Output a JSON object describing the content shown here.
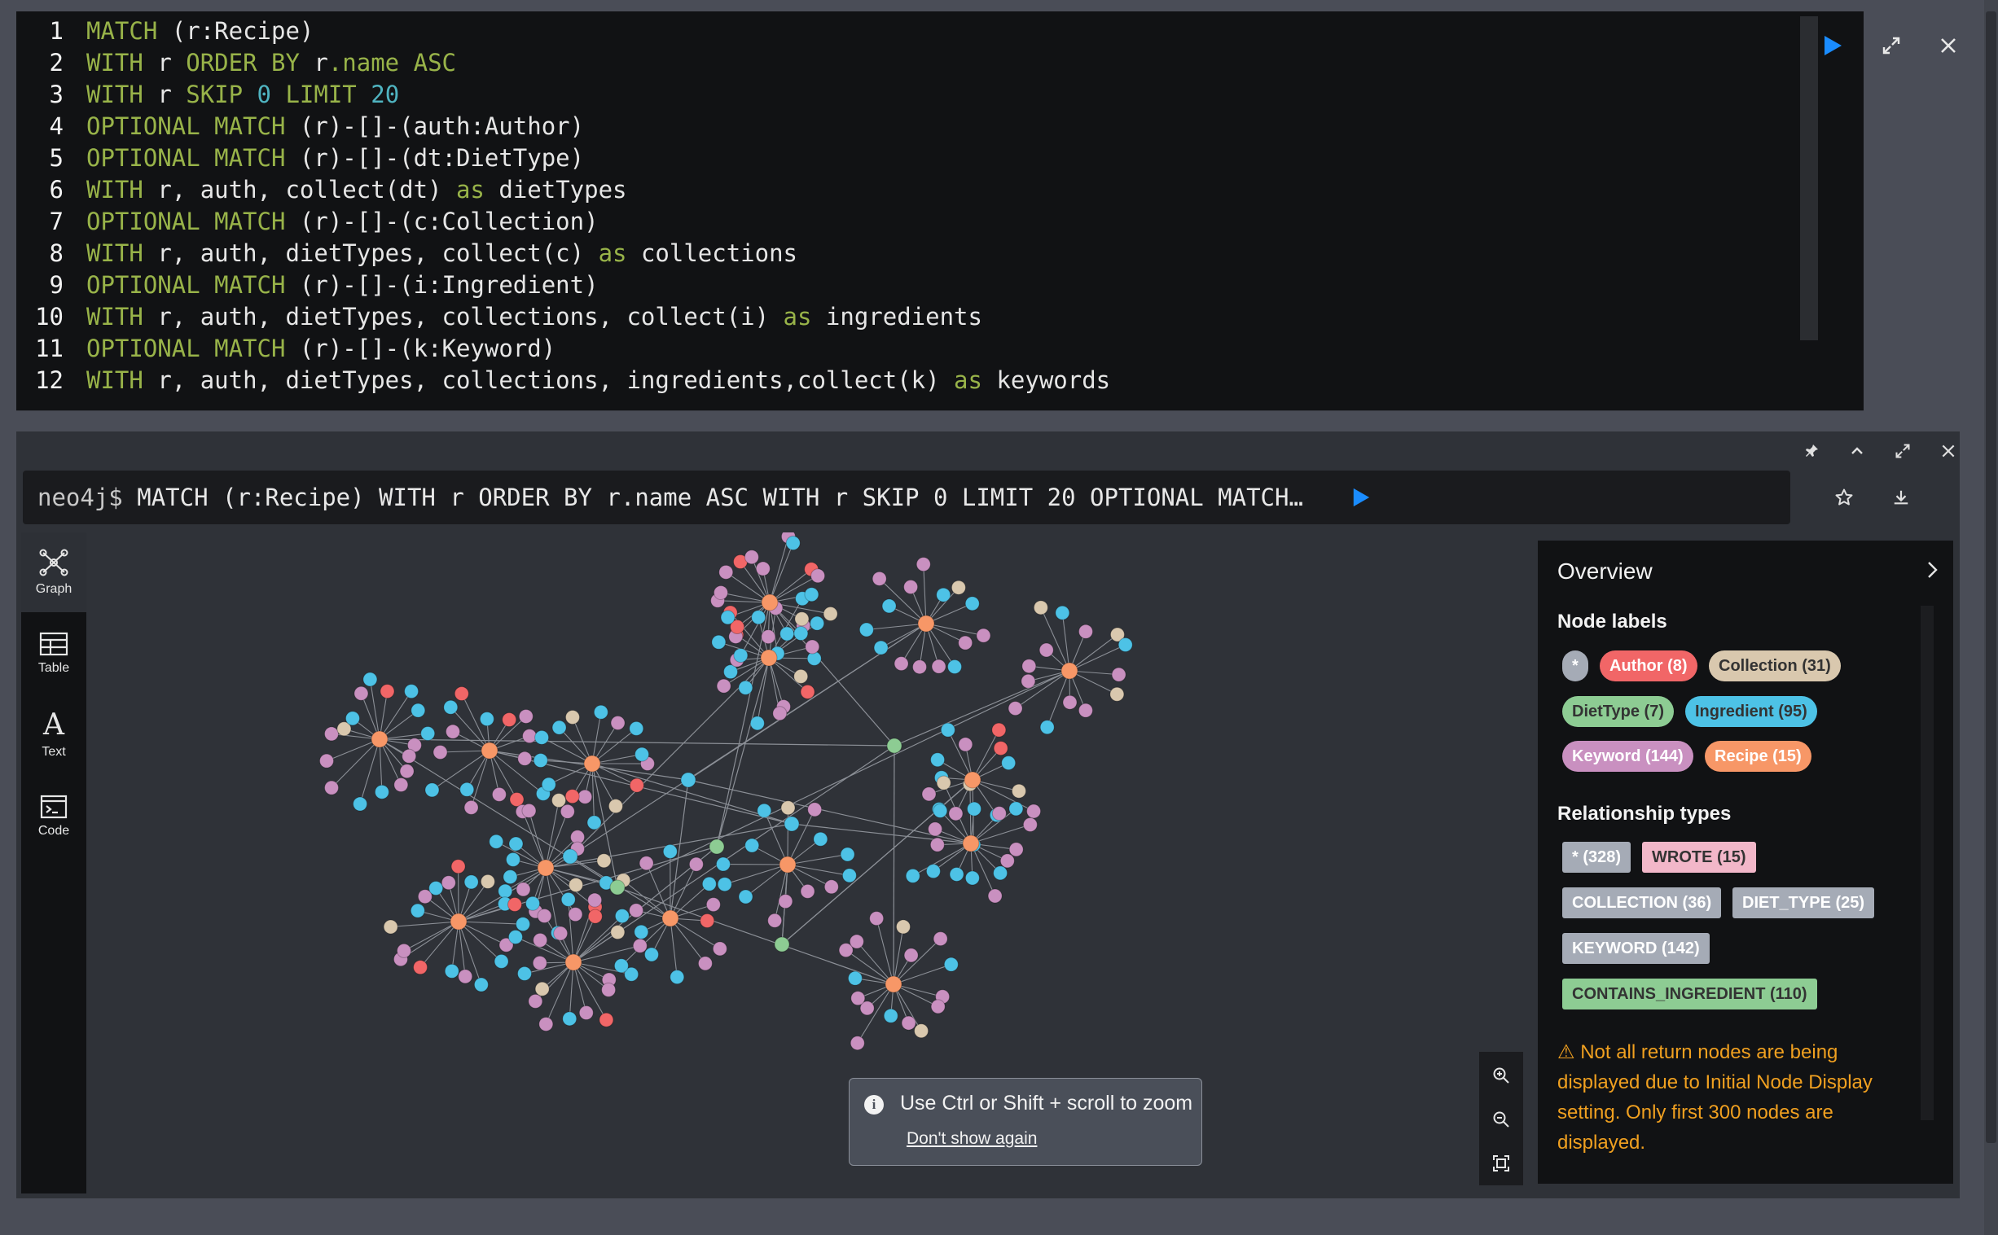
{
  "editor": {
    "lines": [
      {
        "n": "1",
        "tokens": [
          [
            "kw",
            "MATCH "
          ],
          [
            "id",
            "("
          ],
          [
            "id",
            "r:Recipe"
          ],
          [
            "id",
            ")"
          ]
        ]
      },
      {
        "n": "2",
        "tokens": [
          [
            "kw",
            "WITH "
          ],
          [
            "id",
            "r "
          ],
          [
            "kw",
            "ORDER BY "
          ],
          [
            "id",
            "r"
          ],
          [
            "kw",
            ".name "
          ],
          [
            "kw",
            "ASC"
          ]
        ]
      },
      {
        "n": "3",
        "tokens": [
          [
            "kw",
            "WITH "
          ],
          [
            "id",
            "r "
          ],
          [
            "kw",
            "SKIP "
          ],
          [
            "num",
            "0 "
          ],
          [
            "kw",
            "LIMIT "
          ],
          [
            "num",
            "20"
          ]
        ]
      },
      {
        "n": "4",
        "tokens": [
          [
            "kw",
            "OPTIONAL MATCH "
          ],
          [
            "id",
            "(r)-[]-(auth:Author)"
          ]
        ]
      },
      {
        "n": "5",
        "tokens": [
          [
            "kw",
            "OPTIONAL MATCH "
          ],
          [
            "id",
            "(r)-[]-(dt:DietType)"
          ]
        ]
      },
      {
        "n": "6",
        "tokens": [
          [
            "kw",
            "WITH "
          ],
          [
            "id",
            "r, auth, collect(dt) "
          ],
          [
            "kw",
            "as "
          ],
          [
            "id",
            "dietTypes"
          ]
        ]
      },
      {
        "n": "7",
        "tokens": [
          [
            "kw",
            "OPTIONAL MATCH "
          ],
          [
            "id",
            "(r)-[]-(c:Collection)"
          ]
        ]
      },
      {
        "n": "8",
        "tokens": [
          [
            "kw",
            "WITH "
          ],
          [
            "id",
            "r, auth, dietTypes, collect(c) "
          ],
          [
            "kw",
            "as "
          ],
          [
            "id",
            "collections"
          ]
        ]
      },
      {
        "n": "9",
        "tokens": [
          [
            "kw",
            "OPTIONAL MATCH "
          ],
          [
            "id",
            "(r)-[]-(i:Ingredient)"
          ]
        ]
      },
      {
        "n": "10",
        "tokens": [
          [
            "kw",
            "WITH "
          ],
          [
            "id",
            "r, auth, dietTypes, collections, collect(i) "
          ],
          [
            "kw",
            "as "
          ],
          [
            "id",
            "ingredients"
          ]
        ]
      },
      {
        "n": "11",
        "tokens": [
          [
            "kw",
            "OPTIONAL MATCH "
          ],
          [
            "id",
            "(r)-[]-(k:Keyword)"
          ]
        ]
      },
      {
        "n": "12",
        "tokens": [
          [
            "kw",
            "WITH "
          ],
          [
            "id",
            "r, auth, dietTypes, collections, ingredients,collect(k) "
          ],
          [
            "kw",
            "as "
          ],
          [
            "id",
            "keywords"
          ]
        ]
      }
    ]
  },
  "command": {
    "prompt": "neo4j$",
    "text": "MATCH (r:Recipe) WITH r ORDER BY r.name ASC WITH r SKIP 0 LIMIT 20 OPTIONAL MATCH (r)-[]-(auth:Author) OPTIONAL MATCH (r)-[]-(dt:DietType) WITH r, auth, collect(dt) as dietTypes"
  },
  "nav": [
    {
      "label": "Graph",
      "icon": "graph-icon"
    },
    {
      "label": "Table",
      "icon": "table-icon"
    },
    {
      "label": "Text",
      "icon": "text-icon"
    },
    {
      "label": "Code",
      "icon": "code-icon"
    }
  ],
  "toast": {
    "message": "Use Ctrl or Shift + scroll to zoom",
    "link": "Don't show again"
  },
  "overview": {
    "title": "Overview",
    "node_labels_heading": "Node labels",
    "node_labels": [
      {
        "label": "*",
        "color": "#a5abb6",
        "text": "#ffffff"
      },
      {
        "label": "Author (8)",
        "color": "#f16667",
        "text": "#ffffff"
      },
      {
        "label": "Collection (31)",
        "color": "#d9c8ae",
        "text": "#333333"
      },
      {
        "label": "DietType (7)",
        "color": "#8dcc93",
        "text": "#333333"
      },
      {
        "label": "Ingredient (95)",
        "color": "#4dc2e6",
        "text": "#333333"
      },
      {
        "label": "Keyword (144)",
        "color": "#c990c0",
        "text": "#ffffff"
      },
      {
        "label": "Recipe (15)",
        "color": "#f79767",
        "text": "#ffffff"
      }
    ],
    "rel_types_heading": "Relationship types",
    "rel_types": [
      {
        "label": "* (328)",
        "color": "#a5abb6",
        "text": "#ffffff"
      },
      {
        "label": "WROTE (15)",
        "color": "#f2b7c9",
        "text": "#333333"
      },
      {
        "label": "COLLECTION (36)",
        "color": "#a5abb6",
        "text": "#ffffff"
      },
      {
        "label": "DIET_TYPE (25)",
        "color": "#a5abb6",
        "text": "#ffffff"
      },
      {
        "label": "KEYWORD (142)",
        "color": "#a5abb6",
        "text": "#ffffff"
      },
      {
        "label": "CONTAINS_INGREDIENT (110)",
        "color": "#8dcc93",
        "text": "#333333"
      }
    ],
    "warning": "Not all return nodes are being displayed due to Initial Node Display setting. Only first 300 nodes are displayed."
  },
  "colors": {
    "recipe": "#f79767",
    "author": "#f16667",
    "collection": "#d9c8ae",
    "diet": "#8dcc93",
    "ingredient": "#4dc2e6",
    "keyword": "#c990c0",
    "run": "#1a8cff",
    "edge": "#8b8f96"
  }
}
